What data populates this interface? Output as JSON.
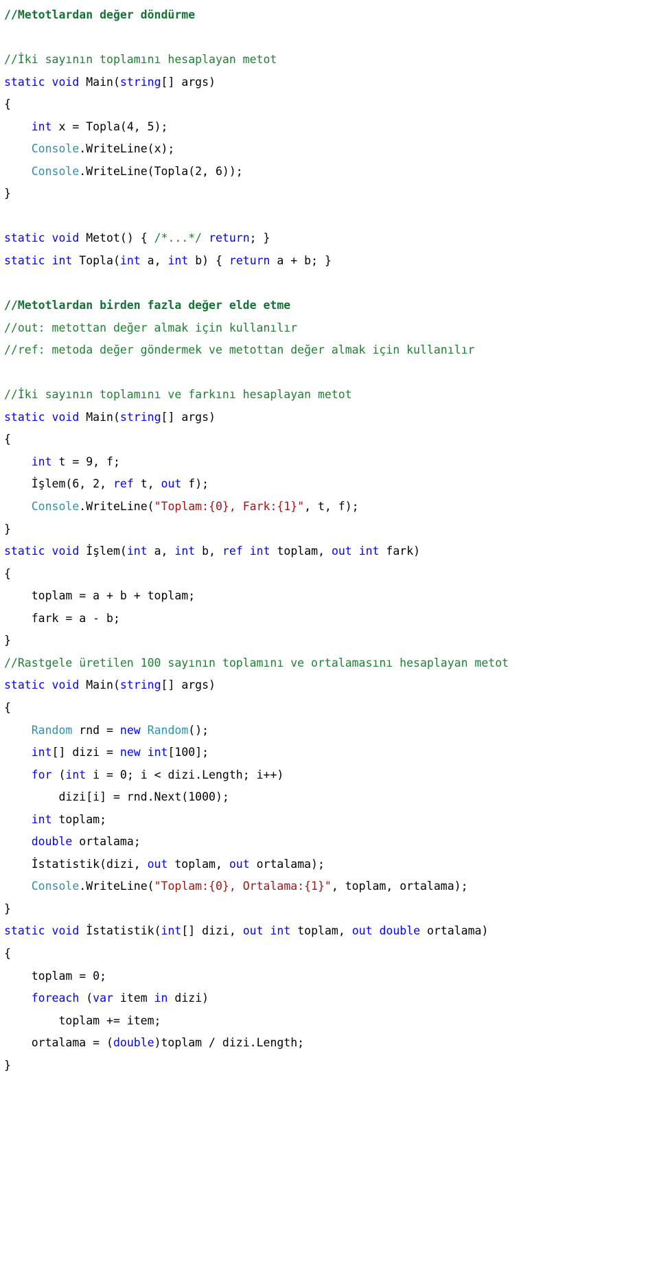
{
  "document": {
    "language": "C#",
    "topic": "Metotlardan deger dondurme",
    "theme": {
      "background": "#ffffff",
      "plain_text": "#000000",
      "keyword": "#0000FF",
      "comment": "#1E8032",
      "comment_heading": "#137333",
      "type_class": "#2B91AF",
      "string_literal": "#A31515"
    }
  },
  "code_lines": [
    {
      "id": "l1",
      "text": "//Metotlardan değer döndürme"
    },
    {
      "id": "l2",
      "text": ""
    },
    {
      "id": "l3",
      "text": "//İki sayının toplamını hesaplayan metot"
    },
    {
      "id": "l4",
      "text": "static void Main(string[] args)"
    },
    {
      "id": "l5",
      "text": "{"
    },
    {
      "id": "l6",
      "text": "    int x = Topla(4, 5);"
    },
    {
      "id": "l7",
      "text": "    Console.WriteLine(x);"
    },
    {
      "id": "l8",
      "text": "    Console.WriteLine(Topla(2, 6));"
    },
    {
      "id": "l9",
      "text": "}"
    },
    {
      "id": "l10",
      "text": ""
    },
    {
      "id": "l11",
      "text": "static void Metot() { /*...*/ return; }"
    },
    {
      "id": "l12",
      "text": "static int Topla(int a, int b) { return a + b; }"
    },
    {
      "id": "l13",
      "text": ""
    },
    {
      "id": "l14",
      "text": "//Metotlardan birden fazla değer elde etme"
    },
    {
      "id": "l15",
      "text": "//out: metottan değer almak için kullanılır"
    },
    {
      "id": "l16",
      "text": "//ref: metoda değer göndermek ve metottan değer almak için kullanılır"
    },
    {
      "id": "l17",
      "text": ""
    },
    {
      "id": "l18",
      "text": "//İki sayının toplamını ve farkını hesaplayan metot"
    },
    {
      "id": "l19",
      "text": "static void Main(string[] args)"
    },
    {
      "id": "l20",
      "text": "{"
    },
    {
      "id": "l21",
      "text": "    int t = 9, f;"
    },
    {
      "id": "l22",
      "text": "    İşlem(6, 2, ref t, out f);"
    },
    {
      "id": "l23",
      "text": "    Console.WriteLine(\"Toplam:{0}, Fark:{1}\", t, f);"
    },
    {
      "id": "l24",
      "text": "}"
    },
    {
      "id": "l25",
      "text": "static void İşlem(int a, int b, ref int toplam, out int fark)"
    },
    {
      "id": "l26",
      "text": "{"
    },
    {
      "id": "l27",
      "text": "    toplam = a + b + toplam;"
    },
    {
      "id": "l28",
      "text": "    fark = a - b;"
    },
    {
      "id": "l29",
      "text": "}"
    },
    {
      "id": "l30",
      "text": "//Rastgele üretilen 100 sayının toplamını ve ortalamasını hesaplayan metot"
    },
    {
      "id": "l31",
      "text": "static void Main(string[] args)"
    },
    {
      "id": "l32",
      "text": "{"
    },
    {
      "id": "l33",
      "text": "    Random rnd = new Random();"
    },
    {
      "id": "l34",
      "text": "    int[] dizi = new int[100];"
    },
    {
      "id": "l35",
      "text": "    for (int i = 0; i < dizi.Length; i++)"
    },
    {
      "id": "l36",
      "text": "        dizi[i] = rnd.Next(1000);"
    },
    {
      "id": "l37",
      "text": "    int toplam;"
    },
    {
      "id": "l38",
      "text": "    double ortalama;"
    },
    {
      "id": "l39",
      "text": "    İstatistik(dizi, out toplam, out ortalama);"
    },
    {
      "id": "l40",
      "text": "    Console.WriteLine(\"Toplam:{0}, Ortalama:{1}\", toplam, ortalama);"
    },
    {
      "id": "l41",
      "text": "}"
    },
    {
      "id": "l42",
      "text": "static void İstatistik(int[] dizi, out int toplam, out double ortalama)"
    },
    {
      "id": "l43",
      "text": "{"
    },
    {
      "id": "l44",
      "text": "    toplam = 0;"
    },
    {
      "id": "l45",
      "text": "    foreach (var item in dizi)"
    },
    {
      "id": "l46",
      "text": "        toplam += item;"
    },
    {
      "id": "l47",
      "text": "    ortalama = (double)toplam / dizi.Length;"
    },
    {
      "id": "l48",
      "text": "}"
    }
  ],
  "tokens": {
    "l1": [
      {
        "t": "//Metotlardan değer döndürme",
        "c": "cmb"
      }
    ],
    "l2": [
      {
        "t": " ",
        "c": "pl"
      }
    ],
    "l3": [
      {
        "t": "//İki sayının toplamını hesaplayan metot",
        "c": "cm"
      }
    ],
    "l4": [
      {
        "t": "static",
        "c": "kw"
      },
      {
        "t": " ",
        "c": "pl"
      },
      {
        "t": "void",
        "c": "kw"
      },
      {
        "t": " Main(",
        "c": "pl"
      },
      {
        "t": "string",
        "c": "kw"
      },
      {
        "t": "[] args)",
        "c": "pl"
      }
    ],
    "l5": [
      {
        "t": "{",
        "c": "pl"
      }
    ],
    "l6": [
      {
        "t": "    ",
        "c": "pl"
      },
      {
        "t": "int",
        "c": "kw"
      },
      {
        "t": " x = Topla(4, 5);",
        "c": "pl"
      }
    ],
    "l7": [
      {
        "t": "    ",
        "c": "pl"
      },
      {
        "t": "Console",
        "c": "cls"
      },
      {
        "t": ".WriteLine(x);",
        "c": "pl"
      }
    ],
    "l8": [
      {
        "t": "    ",
        "c": "pl"
      },
      {
        "t": "Console",
        "c": "cls"
      },
      {
        "t": ".WriteLine(Topla(2, 6));",
        "c": "pl"
      }
    ],
    "l9": [
      {
        "t": "}",
        "c": "pl"
      }
    ],
    "l10": [
      {
        "t": " ",
        "c": "pl"
      }
    ],
    "l11": [
      {
        "t": "static",
        "c": "kw"
      },
      {
        "t": " ",
        "c": "pl"
      },
      {
        "t": "void",
        "c": "kw"
      },
      {
        "t": " Metot() { ",
        "c": "pl"
      },
      {
        "t": "/*...*/",
        "c": "cm"
      },
      {
        "t": " ",
        "c": "pl"
      },
      {
        "t": "return",
        "c": "kw"
      },
      {
        "t": "; }",
        "c": "pl"
      }
    ],
    "l12": [
      {
        "t": "static",
        "c": "kw"
      },
      {
        "t": " ",
        "c": "pl"
      },
      {
        "t": "int",
        "c": "kw"
      },
      {
        "t": " Topla(",
        "c": "pl"
      },
      {
        "t": "int",
        "c": "kw"
      },
      {
        "t": " a, ",
        "c": "pl"
      },
      {
        "t": "int",
        "c": "kw"
      },
      {
        "t": " b) { ",
        "c": "pl"
      },
      {
        "t": "return",
        "c": "kw"
      },
      {
        "t": " a + b; }",
        "c": "pl"
      }
    ],
    "l13": [
      {
        "t": " ",
        "c": "pl"
      }
    ],
    "l14": [
      {
        "t": "//Metotlardan birden fazla değer elde etme",
        "c": "cmb"
      }
    ],
    "l15": [
      {
        "t": "//out: metottan değer almak için kullanılır",
        "c": "cm"
      }
    ],
    "l16": [
      {
        "t": "//ref: metoda değer göndermek ve metottan değer almak için kullanılır",
        "c": "cm"
      }
    ],
    "l17": [
      {
        "t": " ",
        "c": "pl"
      }
    ],
    "l18": [
      {
        "t": "//İki sayının toplamını ve farkını hesaplayan metot",
        "c": "cm"
      }
    ],
    "l19": [
      {
        "t": "static",
        "c": "kw"
      },
      {
        "t": " ",
        "c": "pl"
      },
      {
        "t": "void",
        "c": "kw"
      },
      {
        "t": " Main(",
        "c": "pl"
      },
      {
        "t": "string",
        "c": "kw"
      },
      {
        "t": "[] args)",
        "c": "pl"
      }
    ],
    "l20": [
      {
        "t": "{",
        "c": "pl"
      }
    ],
    "l21": [
      {
        "t": "    ",
        "c": "pl"
      },
      {
        "t": "int",
        "c": "kw"
      },
      {
        "t": " t = 9, f;",
        "c": "pl"
      }
    ],
    "l22": [
      {
        "t": "    İşlem(6, 2, ",
        "c": "pl"
      },
      {
        "t": "ref",
        "c": "kw"
      },
      {
        "t": " t, ",
        "c": "pl"
      },
      {
        "t": "out",
        "c": "kw"
      },
      {
        "t": " f);",
        "c": "pl"
      }
    ],
    "l23": [
      {
        "t": "    ",
        "c": "pl"
      },
      {
        "t": "Console",
        "c": "cls"
      },
      {
        "t": ".WriteLine(",
        "c": "pl"
      },
      {
        "t": "\"Toplam:{0}, Fark:{1}\"",
        "c": "str"
      },
      {
        "t": ", t, f);",
        "c": "pl"
      }
    ],
    "l24": [
      {
        "t": "}",
        "c": "pl"
      }
    ],
    "l25": [
      {
        "t": "static",
        "c": "kw"
      },
      {
        "t": " ",
        "c": "pl"
      },
      {
        "t": "void",
        "c": "kw"
      },
      {
        "t": " İşlem(",
        "c": "pl"
      },
      {
        "t": "int",
        "c": "kw"
      },
      {
        "t": " a, ",
        "c": "pl"
      },
      {
        "t": "int",
        "c": "kw"
      },
      {
        "t": " b, ",
        "c": "pl"
      },
      {
        "t": "ref",
        "c": "kw"
      },
      {
        "t": " ",
        "c": "pl"
      },
      {
        "t": "int",
        "c": "kw"
      },
      {
        "t": " toplam, ",
        "c": "pl"
      },
      {
        "t": "out",
        "c": "kw"
      },
      {
        "t": " ",
        "c": "pl"
      },
      {
        "t": "int",
        "c": "kw"
      },
      {
        "t": " fark)",
        "c": "pl"
      }
    ],
    "l26": [
      {
        "t": "{",
        "c": "pl"
      }
    ],
    "l27": [
      {
        "t": "    toplam = a + b + toplam;",
        "c": "pl"
      }
    ],
    "l28": [
      {
        "t": "    fark = a - b;",
        "c": "pl"
      }
    ],
    "l29": [
      {
        "t": "}",
        "c": "pl"
      }
    ],
    "l30": [
      {
        "t": "//Rastgele üretilen 100 sayının toplamını ve ortalamasını hesaplayan metot",
        "c": "cm"
      }
    ],
    "l31": [
      {
        "t": "static",
        "c": "kw"
      },
      {
        "t": " ",
        "c": "pl"
      },
      {
        "t": "void",
        "c": "kw"
      },
      {
        "t": " Main(",
        "c": "pl"
      },
      {
        "t": "string",
        "c": "kw"
      },
      {
        "t": "[] args)",
        "c": "pl"
      }
    ],
    "l32": [
      {
        "t": "{",
        "c": "pl"
      }
    ],
    "l33": [
      {
        "t": "    ",
        "c": "pl"
      },
      {
        "t": "Random",
        "c": "cls"
      },
      {
        "t": " rnd = ",
        "c": "pl"
      },
      {
        "t": "new",
        "c": "kw"
      },
      {
        "t": " ",
        "c": "pl"
      },
      {
        "t": "Random",
        "c": "cls"
      },
      {
        "t": "();",
        "c": "pl"
      }
    ],
    "l34": [
      {
        "t": "    ",
        "c": "pl"
      },
      {
        "t": "int",
        "c": "kw"
      },
      {
        "t": "[] dizi = ",
        "c": "pl"
      },
      {
        "t": "new",
        "c": "kw"
      },
      {
        "t": " ",
        "c": "pl"
      },
      {
        "t": "int",
        "c": "kw"
      },
      {
        "t": "[100];",
        "c": "pl"
      }
    ],
    "l35": [
      {
        "t": "    ",
        "c": "pl"
      },
      {
        "t": "for",
        "c": "kw"
      },
      {
        "t": " (",
        "c": "pl"
      },
      {
        "t": "int",
        "c": "kw"
      },
      {
        "t": " i = 0; i < dizi.Length; i++)",
        "c": "pl"
      }
    ],
    "l36": [
      {
        "t": "        dizi[i] = rnd.Next(1000);",
        "c": "pl"
      }
    ],
    "l37": [
      {
        "t": "    ",
        "c": "pl"
      },
      {
        "t": "int",
        "c": "kw"
      },
      {
        "t": " toplam;",
        "c": "pl"
      }
    ],
    "l38": [
      {
        "t": "    ",
        "c": "pl"
      },
      {
        "t": "double",
        "c": "kw"
      },
      {
        "t": " ortalama;",
        "c": "pl"
      }
    ],
    "l39": [
      {
        "t": "    İstatistik(dizi, ",
        "c": "pl"
      },
      {
        "t": "out",
        "c": "kw"
      },
      {
        "t": " toplam, ",
        "c": "pl"
      },
      {
        "t": "out",
        "c": "kw"
      },
      {
        "t": " ortalama);",
        "c": "pl"
      }
    ],
    "l40": [
      {
        "t": "    ",
        "c": "pl"
      },
      {
        "t": "Console",
        "c": "cls"
      },
      {
        "t": ".WriteLine(",
        "c": "pl"
      },
      {
        "t": "\"Toplam:{0}, Ortalama:{1}\"",
        "c": "str"
      },
      {
        "t": ", toplam, ortalama);",
        "c": "pl"
      }
    ],
    "l41": [
      {
        "t": "}",
        "c": "pl"
      }
    ],
    "l42": [
      {
        "t": "static",
        "c": "kw"
      },
      {
        "t": " ",
        "c": "pl"
      },
      {
        "t": "void",
        "c": "kw"
      },
      {
        "t": " İstatistik(",
        "c": "pl"
      },
      {
        "t": "int",
        "c": "kw"
      },
      {
        "t": "[] dizi, ",
        "c": "pl"
      },
      {
        "t": "out",
        "c": "kw"
      },
      {
        "t": " ",
        "c": "pl"
      },
      {
        "t": "int",
        "c": "kw"
      },
      {
        "t": " toplam, ",
        "c": "pl"
      },
      {
        "t": "out",
        "c": "kw"
      },
      {
        "t": " ",
        "c": "pl"
      },
      {
        "t": "double",
        "c": "kw"
      },
      {
        "t": " ortalama)",
        "c": "pl"
      }
    ],
    "l43": [
      {
        "t": "{",
        "c": "pl"
      }
    ],
    "l44": [
      {
        "t": "    toplam = 0;",
        "c": "pl"
      }
    ],
    "l45": [
      {
        "t": "    ",
        "c": "pl"
      },
      {
        "t": "foreach",
        "c": "kw"
      },
      {
        "t": " (",
        "c": "pl"
      },
      {
        "t": "var",
        "c": "kw"
      },
      {
        "t": " item ",
        "c": "pl"
      },
      {
        "t": "in",
        "c": "kw"
      },
      {
        "t": " dizi)",
        "c": "pl"
      }
    ],
    "l46": [
      {
        "t": "        toplam += item;",
        "c": "pl"
      }
    ],
    "l47": [
      {
        "t": "    ortalama = (",
        "c": "pl"
      },
      {
        "t": "double",
        "c": "kw"
      },
      {
        "t": ")toplam / dizi.Length;",
        "c": "pl"
      }
    ],
    "l48": [
      {
        "t": "}",
        "c": "pl"
      }
    ]
  }
}
